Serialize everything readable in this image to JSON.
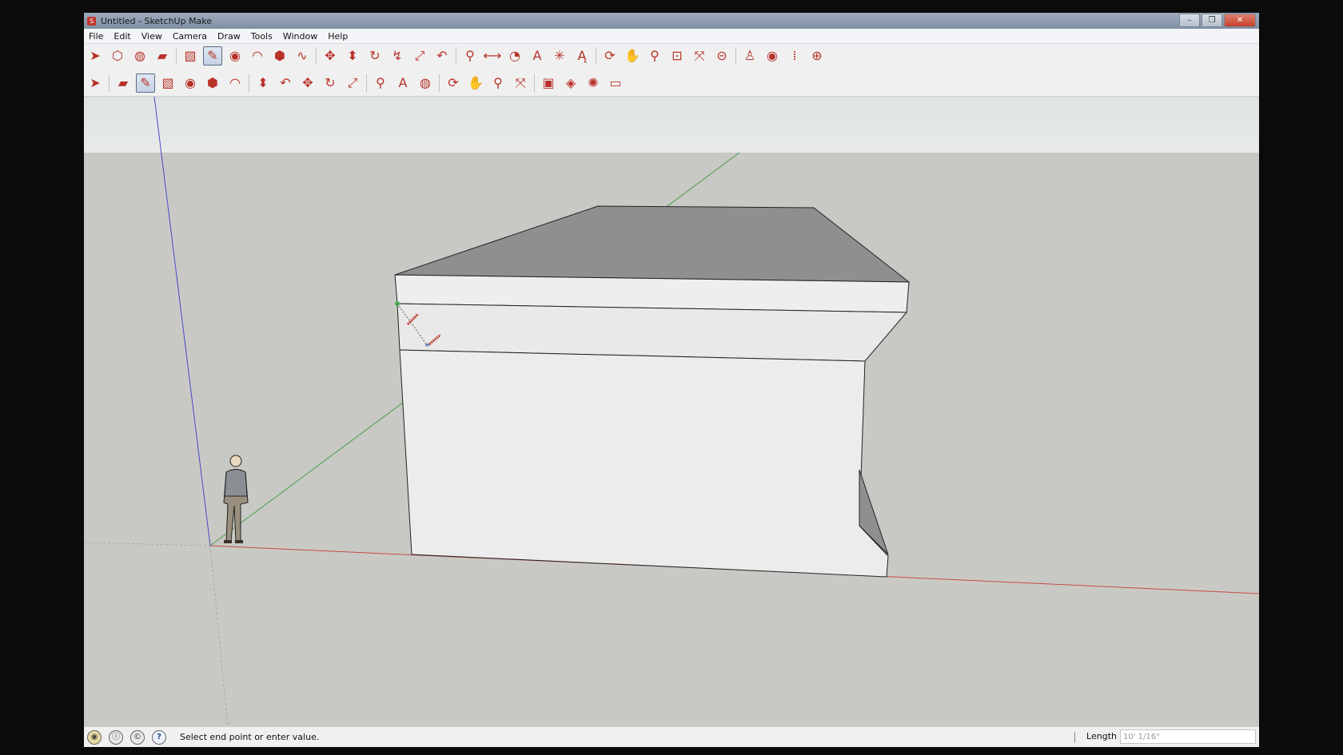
{
  "window": {
    "title": "Untitled - SketchUp Make"
  },
  "menu": [
    "File",
    "Edit",
    "View",
    "Camera",
    "Draw",
    "Tools",
    "Window",
    "Help"
  ],
  "toolbar_primary": [
    {
      "name": "select-tool",
      "icon": "arrow-icon",
      "glyph": "➤"
    },
    {
      "name": "make-component-tool",
      "icon": "component-icon",
      "glyph": "⬡"
    },
    {
      "name": "paint-bucket-tool",
      "icon": "paint-bucket-icon",
      "glyph": "◍"
    },
    {
      "name": "eraser-tool",
      "icon": "eraser-icon",
      "glyph": "▰"
    },
    {
      "sep": true
    },
    {
      "name": "rectangle-tool",
      "icon": "rectangle-icon",
      "glyph": "▧"
    },
    {
      "name": "line-tool",
      "icon": "pencil-icon",
      "glyph": "✎",
      "active": true
    },
    {
      "name": "circle-tool",
      "icon": "circle-icon",
      "glyph": "◉"
    },
    {
      "name": "arc-tool",
      "icon": "arc-icon",
      "glyph": "◠"
    },
    {
      "name": "polygon-tool",
      "icon": "polygon-icon",
      "glyph": "⬢"
    },
    {
      "name": "freehand-tool",
      "icon": "freehand-icon",
      "glyph": "∿"
    },
    {
      "sep": true
    },
    {
      "name": "move-tool",
      "icon": "move-icon",
      "glyph": "✥"
    },
    {
      "name": "push-pull-tool",
      "icon": "push-pull-icon",
      "glyph": "⬍"
    },
    {
      "name": "rotate-tool",
      "icon": "rotate-icon",
      "glyph": "↻"
    },
    {
      "name": "follow-me-tool",
      "icon": "follow-me-icon",
      "glyph": "↯"
    },
    {
      "name": "scale-tool",
      "icon": "scale-icon",
      "glyph": "⤢"
    },
    {
      "name": "offset-tool",
      "icon": "offset-icon",
      "glyph": "↶"
    },
    {
      "sep": true
    },
    {
      "name": "tape-measure-tool",
      "icon": "tape-measure-icon",
      "glyph": "⚲"
    },
    {
      "name": "dimension-tool",
      "icon": "dimension-icon",
      "glyph": "⟷"
    },
    {
      "name": "protractor-tool",
      "icon": "protractor-icon",
      "glyph": "◔"
    },
    {
      "name": "text-tool",
      "icon": "text-icon",
      "glyph": "A"
    },
    {
      "name": "axes-tool",
      "icon": "axes-icon",
      "glyph": "✳"
    },
    {
      "name": "3d-text-tool",
      "icon": "3d-text-icon",
      "glyph": "Ą"
    },
    {
      "sep": true
    },
    {
      "name": "orbit-tool",
      "icon": "orbit-icon",
      "glyph": "⟳"
    },
    {
      "name": "pan-tool",
      "icon": "hand-icon",
      "glyph": "✋"
    },
    {
      "name": "zoom-tool",
      "icon": "magnifier-icon",
      "glyph": "⚲"
    },
    {
      "name": "zoom-window-tool",
      "icon": "zoom-window-icon",
      "glyph": "⊡"
    },
    {
      "name": "zoom-extents-tool",
      "icon": "zoom-extents-icon",
      "glyph": "⤧"
    },
    {
      "name": "previous-view-tool",
      "icon": "previous-view-icon",
      "glyph": "⊝"
    },
    {
      "sep": true
    },
    {
      "name": "position-camera-tool",
      "icon": "position-camera-icon",
      "glyph": "♙"
    },
    {
      "name": "look-around-tool",
      "icon": "eye-icon",
      "glyph": "◉"
    },
    {
      "name": "walk-tool",
      "icon": "footprints-icon",
      "glyph": "⁞"
    },
    {
      "name": "section-plane-tool",
      "icon": "section-plane-icon",
      "glyph": "⊕"
    }
  ],
  "toolbar_secondary": [
    {
      "name": "select-tool-2",
      "icon": "arrow-icon",
      "glyph": "➤"
    },
    {
      "sep": true
    },
    {
      "name": "eraser-tool-2",
      "icon": "eraser-icon",
      "glyph": "▰"
    },
    {
      "name": "line-tool-2",
      "icon": "pencil-icon",
      "glyph": "✎",
      "active": true
    },
    {
      "name": "rectangle-tool-2",
      "icon": "rectangle-icon",
      "glyph": "▧"
    },
    {
      "name": "circle-tool-2",
      "icon": "circle-icon",
      "glyph": "◉"
    },
    {
      "name": "polygon-tool-2",
      "icon": "polygon-icon",
      "glyph": "⬢"
    },
    {
      "name": "arc-tool-2",
      "icon": "arc-icon",
      "glyph": "◠"
    },
    {
      "sep": true
    },
    {
      "name": "push-pull-tool-2",
      "icon": "push-pull-icon",
      "glyph": "⬍"
    },
    {
      "name": "offset-tool-2",
      "icon": "offset-icon",
      "glyph": "↶"
    },
    {
      "name": "move-tool-2",
      "icon": "move-icon",
      "glyph": "✥"
    },
    {
      "name": "rotate-tool-2",
      "icon": "rotate-icon",
      "glyph": "↻"
    },
    {
      "name": "scale-tool-2",
      "icon": "scale-icon",
      "glyph": "⤢"
    },
    {
      "sep": true
    },
    {
      "name": "tape-measure-tool-2",
      "icon": "tape-measure-icon",
      "glyph": "⚲"
    },
    {
      "name": "text-tool-2",
      "icon": "text-icon",
      "glyph": "A"
    },
    {
      "name": "paint-bucket-tool-2",
      "icon": "paint-bucket-icon",
      "glyph": "◍"
    },
    {
      "sep": true
    },
    {
      "name": "orbit-tool-2",
      "icon": "orbit-icon",
      "glyph": "⟳"
    },
    {
      "name": "pan-tool-2",
      "icon": "hand-icon",
      "glyph": "✋"
    },
    {
      "name": "zoom-tool-2",
      "icon": "magnifier-icon",
      "glyph": "⚲"
    },
    {
      "name": "zoom-extents-tool-2",
      "icon": "zoom-extents-icon",
      "glyph": "⤧"
    },
    {
      "sep": true
    },
    {
      "name": "3d-warehouse-tool",
      "icon": "3d-warehouse-icon",
      "glyph": "▣"
    },
    {
      "name": "share-component-tool",
      "icon": "share-component-icon",
      "glyph": "◈"
    },
    {
      "name": "extension-warehouse-tool",
      "icon": "extension-warehouse-icon",
      "glyph": "✺"
    },
    {
      "name": "share-model-tool",
      "icon": "share-model-icon",
      "glyph": "▭"
    }
  ],
  "status": {
    "icons": [
      {
        "name": "geo-location-icon",
        "glyph": "◉",
        "cls": "geo"
      },
      {
        "name": "credits-icon",
        "glyph": "ⓘ",
        "cls": "credit"
      },
      {
        "name": "user-account-icon",
        "glyph": "©",
        "cls": "credit"
      },
      {
        "name": "help-icon",
        "glyph": "?",
        "cls": "help"
      }
    ],
    "message": "Select end point or enter value.",
    "measurement_label": "Length",
    "measurement_value": "10' 1/16\""
  },
  "colors": {
    "sky": "#e3e6e6",
    "ground": "#c8c9c4",
    "face_front": "#ececec",
    "face_top": "#909090",
    "red_axis": "#c84a4a",
    "green_axis": "#4c9a4c",
    "blue_axis": "#4a4ac8",
    "line_tool": "#c0392b"
  }
}
